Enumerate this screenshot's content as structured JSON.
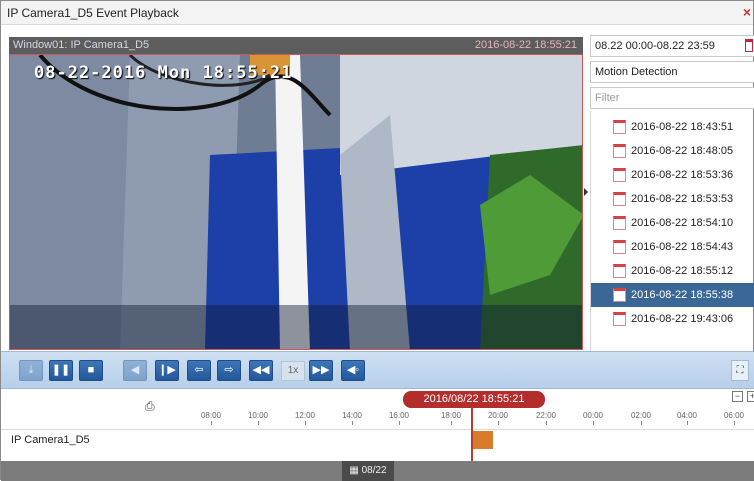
{
  "window": {
    "title": "IP Camera1_D5 Event Playback",
    "close_icon": "close-icon"
  },
  "video": {
    "window_name": "Window01: IP Camera1_D5",
    "window_time": "2016-08-22 18:55:21",
    "osd_text": "08-22-2016 Mon 18:55:21"
  },
  "sidebar": {
    "time_range": "08.22 00:00-08.22 23:59",
    "event_type": "Motion Detection",
    "filter_placeholder": "Filter",
    "events": [
      {
        "label": "2016-08-22 18:43:51",
        "selected": false
      },
      {
        "label": "2016-08-22 18:48:05",
        "selected": false
      },
      {
        "label": "2016-08-22 18:53:36",
        "selected": false
      },
      {
        "label": "2016-08-22 18:53:53",
        "selected": false
      },
      {
        "label": "2016-08-22 18:54:10",
        "selected": false
      },
      {
        "label": "2016-08-22 18:54:43",
        "selected": false
      },
      {
        "label": "2016-08-22 18:55:12",
        "selected": false
      },
      {
        "label": "2016-08-22 18:55:38",
        "selected": true
      },
      {
        "label": "2016-08-22 19:43:06",
        "selected": false
      }
    ]
  },
  "toolbar": {
    "speed_label": "1x",
    "buttons": [
      "download-icon",
      "pause-icon",
      "stop-icon",
      "reverse-icon",
      "single-frame-icon",
      "prev-icon",
      "next-icon",
      "slow-icon",
      "fast-icon",
      "audio-icon",
      "fullscreen-icon"
    ]
  },
  "timeline": {
    "current_time": "2016/08/22 18:55:21",
    "ticks": [
      "08:00",
      "10:00",
      "12:00",
      "14:00",
      "16:00",
      "18:00",
      "20:00",
      "22:00",
      "00:00",
      "02:00",
      "04:00",
      "06:00"
    ],
    "track_label": "IP Camera1_D5",
    "date_label": "08/22",
    "zoom_out": "−",
    "zoom_in": "+"
  },
  "colors": {
    "accent": "#3a6796",
    "cursor": "#c0392b",
    "record": "#d77c2a"
  }
}
